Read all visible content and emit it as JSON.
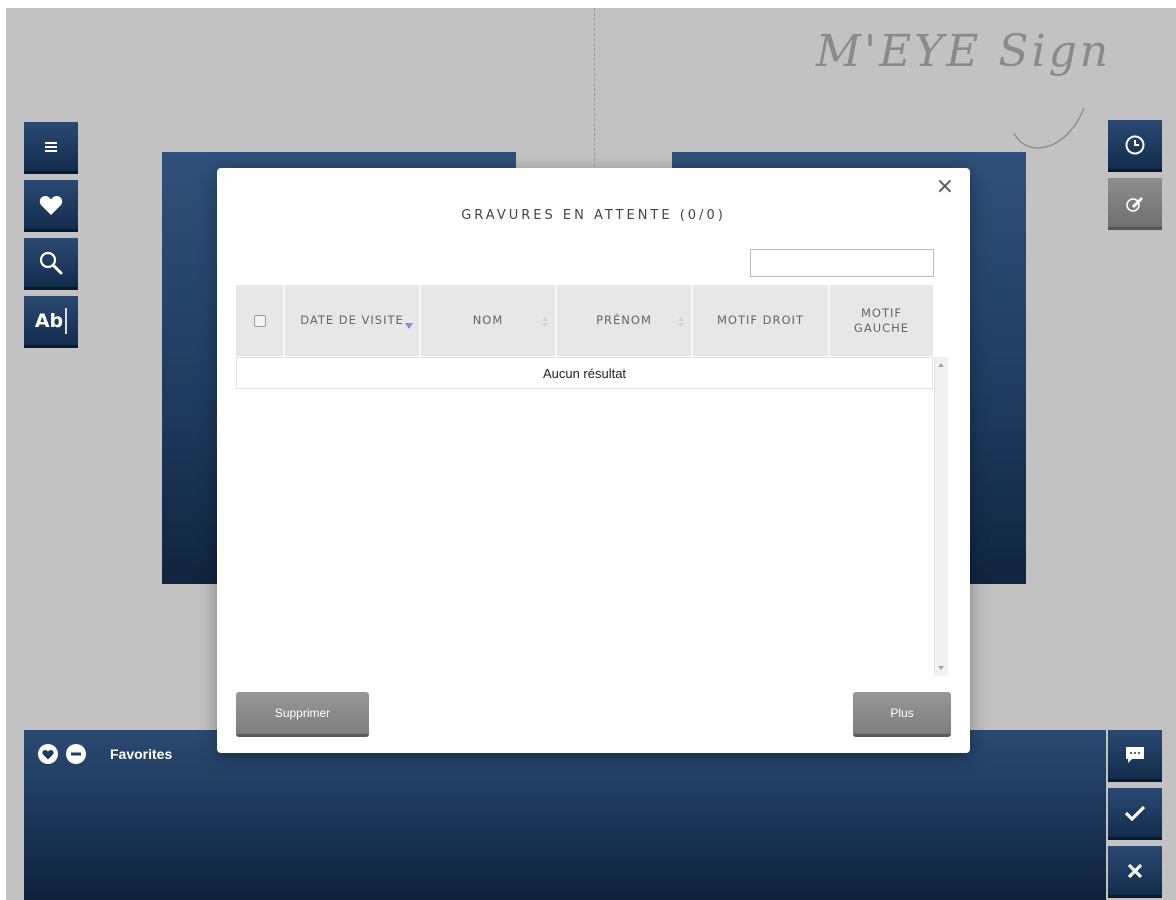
{
  "brand": {
    "text": "M'EYE Sign"
  },
  "modal": {
    "title": "GRAVURES EN ATTENTE (0/0)",
    "close_label": "×",
    "search": {
      "value": "",
      "placeholder": ""
    },
    "table": {
      "columns": [
        "DATE DE VISITE",
        "NOM",
        "PRÉNOM",
        "MOTIF DROIT",
        "MOTIF GAUCHE"
      ],
      "sorted_column": "DATE DE VISITE",
      "sort_direction": "descending",
      "empty_message": "Aucun résultat"
    },
    "buttons": {
      "delete": "Supprimer",
      "more": "Plus"
    }
  },
  "left_toolbar": {
    "items": [
      {
        "icon": "menu-icon"
      },
      {
        "icon": "heart-icon"
      },
      {
        "icon": "search-icon"
      },
      {
        "icon": "text-tool-icon",
        "label": "Ab"
      }
    ]
  },
  "right_toolbar": {
    "items": [
      {
        "icon": "clock-icon"
      },
      {
        "icon": "pen-icon",
        "disabled": true
      }
    ]
  },
  "favorites_bar": {
    "label": "Favorites",
    "icons": [
      "heart-icon",
      "minus-icon"
    ]
  },
  "action_buttons": {
    "items": [
      {
        "icon": "comment-icon"
      },
      {
        "icon": "check-icon"
      },
      {
        "icon": "close-icon"
      }
    ]
  },
  "colors": {
    "background": "#c2c2c2",
    "navy": "#1f3c60",
    "grey_button": "#8a8a8a",
    "sort_indicator": "#7b8fd4"
  }
}
